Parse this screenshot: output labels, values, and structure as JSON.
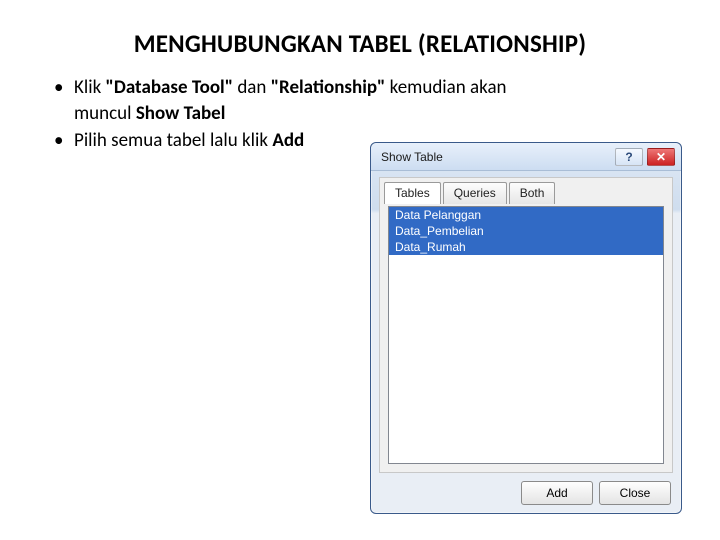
{
  "title": "MENGHUBUNGKAN TABEL (RELATIONSHIP)",
  "bullets": {
    "b1": {
      "t1": "Klik ",
      "bold1": "\"Database Tool\"",
      "t2": " dan ",
      "bold2": "\"Relationship\"",
      "t3": " kemudian akan muncul ",
      "bold3": "Show Tabel"
    },
    "b2": {
      "t1": "Pilih semua tabel lalu klik ",
      "bold1": "Add"
    }
  },
  "dialog": {
    "title": "Show Table",
    "help_glyph": "?",
    "close_glyph": "✕",
    "tabs": {
      "tables": "Tables",
      "queries": "Queries",
      "both": "Both"
    },
    "items": [
      "Data Pelanggan",
      "Data_Pembelian",
      "Data_Rumah"
    ],
    "add": "Add",
    "close": "Close"
  }
}
